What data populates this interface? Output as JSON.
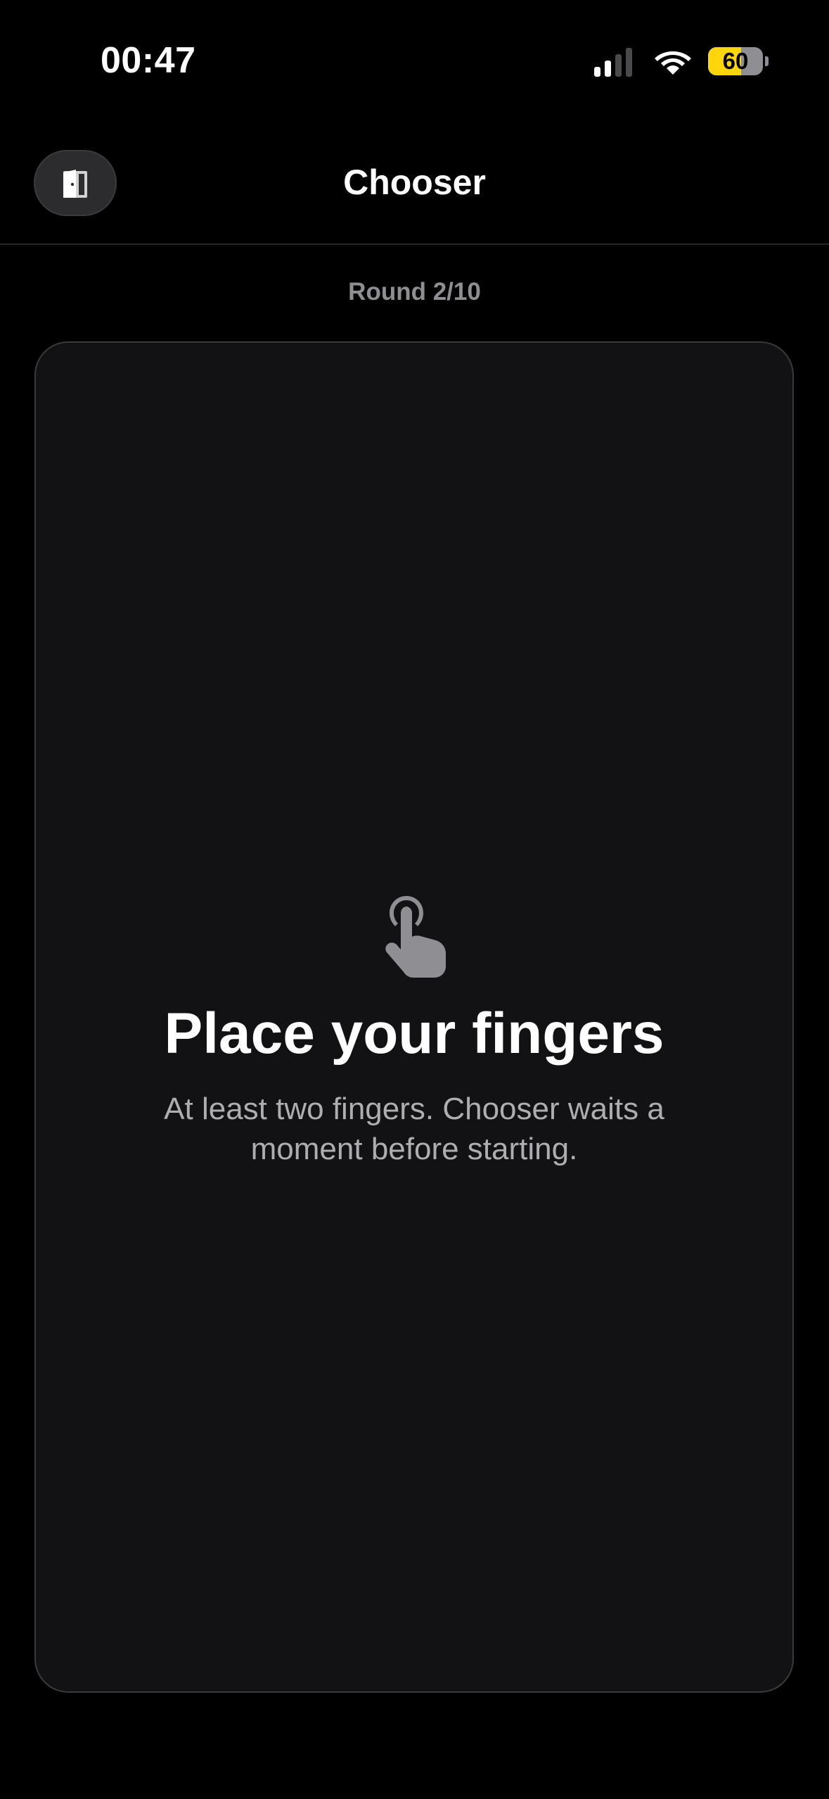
{
  "status_bar": {
    "time": "00:47",
    "battery_level": "60",
    "battery_fraction": 0.6,
    "signal_bars_active": 2,
    "signal_bars_total": 4,
    "icons": [
      "cellular-signal-icon",
      "wifi-icon",
      "battery-icon"
    ],
    "battery_color": "#ffd60a"
  },
  "nav": {
    "title": "Chooser",
    "exit_icon": "door-exit-icon"
  },
  "round": {
    "label": "Round 2/10"
  },
  "touch_area": {
    "icon": "hand-point-up-icon",
    "title": "Place your fingers",
    "subtitle": "At least two fingers. Chooser waits a moment before starting."
  },
  "colors": {
    "background": "#000000",
    "surface": "#121214",
    "secondary_text": "#8e8e93",
    "icon_gray": "#8e8e93"
  }
}
